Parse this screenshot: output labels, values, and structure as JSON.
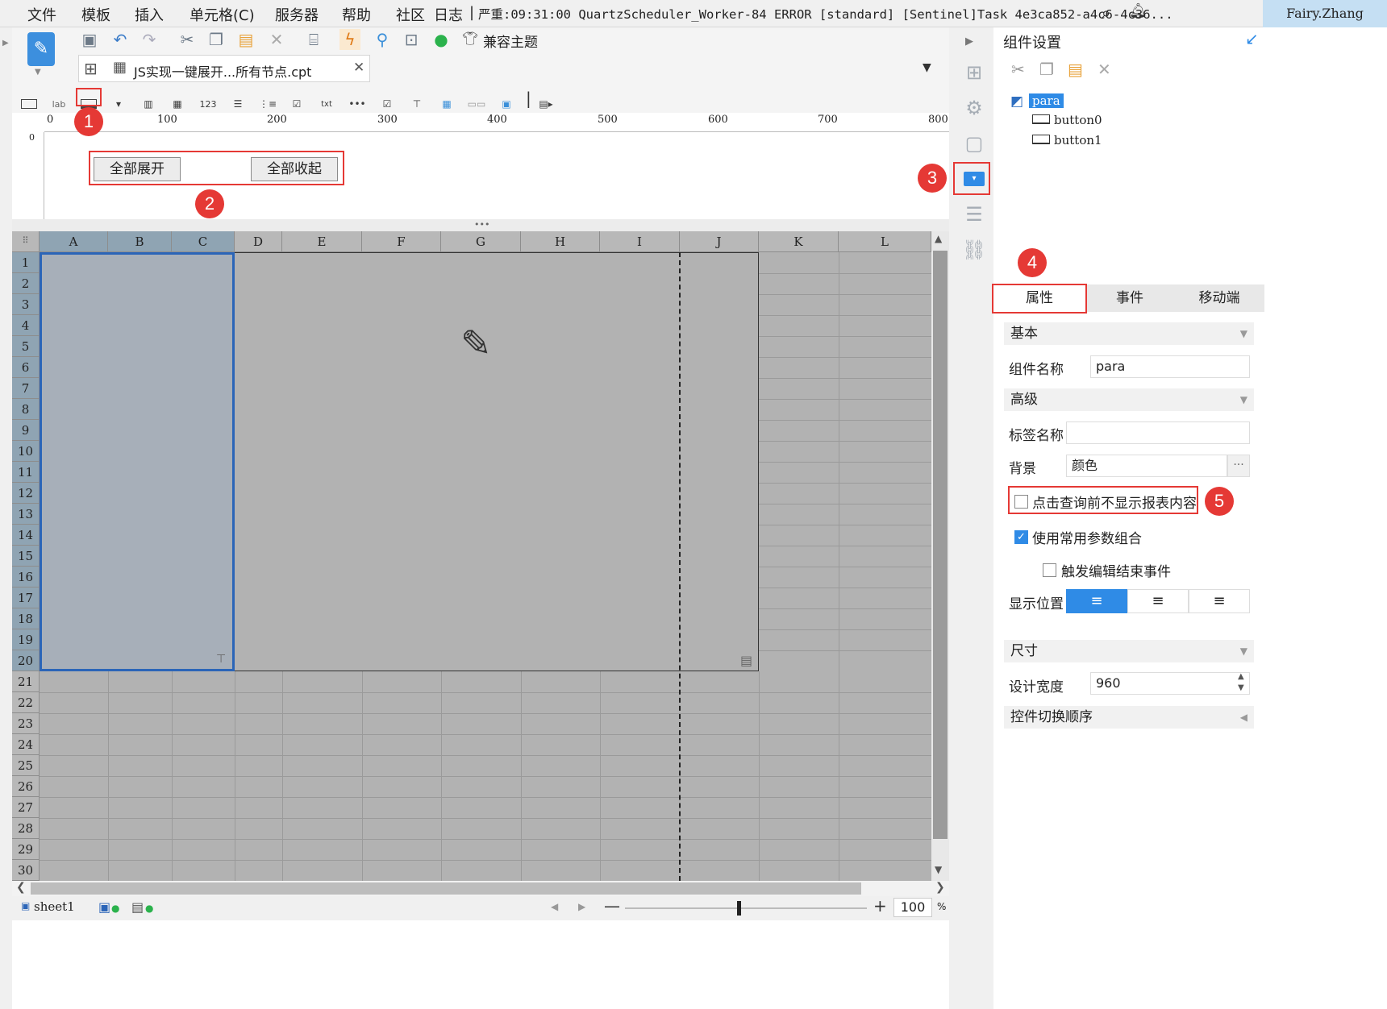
{
  "menu": [
    "文件",
    "模板",
    "插入",
    "单元格(C)",
    "服务器",
    "帮助",
    "社区"
  ],
  "log": {
    "label": "日志",
    "text": "严重:09:31:00 QuartzScheduler_Worker-84 ERROR [standard] [Sentinel]Task 4e3ca852-a4c6-4c36..."
  },
  "user": "Fairy.Zhang",
  "toolbar": {
    "theme_label": "兼容主题"
  },
  "tab": {
    "filename": "JS实现一键展开...所有节点.cpt"
  },
  "ruler": [
    "0",
    "100",
    "200",
    "300",
    "400",
    "500",
    "600",
    "700",
    "800"
  ],
  "param_panel": {
    "expand_button": "全部展开",
    "collapse_button": "全部收起"
  },
  "grid": {
    "columns": [
      "A",
      "B",
      "C",
      "D",
      "E",
      "F",
      "G",
      "H",
      "I",
      "J",
      "K",
      "L"
    ],
    "rows": [
      "1",
      "2",
      "3",
      "4",
      "5",
      "6",
      "7",
      "8",
      "9",
      "10",
      "11",
      "12",
      "13",
      "14",
      "15",
      "16",
      "17",
      "18",
      "19",
      "20",
      "21",
      "22",
      "23",
      "24",
      "25",
      "26",
      "27",
      "28",
      "29",
      "30"
    ]
  },
  "sheet": {
    "name": "sheet1",
    "zoom": "100",
    "zoom_unit": "%"
  },
  "annotations": [
    "1",
    "2",
    "3",
    "4",
    "5"
  ],
  "panel": {
    "title": "组件设置",
    "tree": {
      "root": "para",
      "children": [
        "button0",
        "button1"
      ]
    },
    "tabs": [
      "属性",
      "事件",
      "移动端"
    ],
    "basic_section": "基本",
    "name_label": "组件名称",
    "name_value": "para",
    "advanced_section": "高级",
    "label_name_label": "标签名称",
    "label_name_value": "",
    "bg_label": "背景",
    "bg_value": "颜色",
    "hide_before_query": "点击查询前不显示报表内容",
    "use_common_params": "使用常用参数组合",
    "trigger_edit_end": "触发编辑结束事件",
    "position_label": "显示位置",
    "size_section": "尺寸",
    "design_width_label": "设计宽度",
    "design_width_value": "960",
    "switch_order_section": "控件切换顺序"
  }
}
